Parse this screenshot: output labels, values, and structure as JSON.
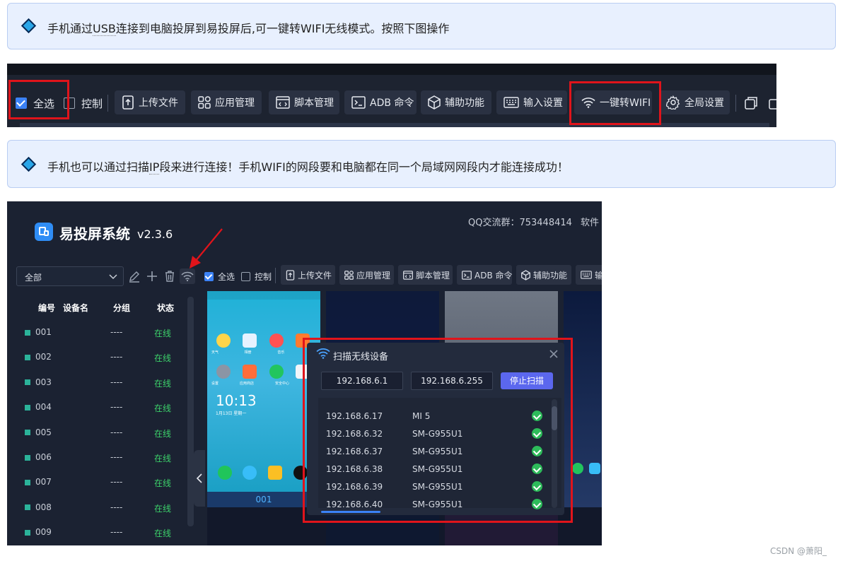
{
  "note1": {
    "pre": "手机通过",
    "usb": "USB",
    "post": "连接到电脑投屏到易投屏后,可一键转WIFI无线模式。按照下图操作"
  },
  "note2": {
    "pre": "手机也可以通过扫描",
    "ip": "IP",
    "post": "段来进行连接！手机WIFI的网段要和电脑都在同一个局域网网段内才能连接成功！"
  },
  "toolbar": {
    "select_all": "全选",
    "control": "控制",
    "upload": "上传文件",
    "apps": "应用管理",
    "scripts": "脚本管理",
    "adb": "ADB 命令",
    "assist": "辅助功能",
    "input": "输入设置",
    "wifi": "一键转WIFI",
    "global": "全局设置"
  },
  "app": {
    "title": "易投屏系统",
    "version": "v2.3.6",
    "qq": "QQ交流群：753448414",
    "software_partial": "软件",
    "group_select": "全部",
    "columns": {
      "id": "编号",
      "name": "设备名",
      "group": "分组",
      "status": "状态"
    },
    "devices": [
      {
        "id": "001",
        "group": "----",
        "status": "在线"
      },
      {
        "id": "002",
        "group": "----",
        "status": "在线"
      },
      {
        "id": "003",
        "group": "----",
        "status": "在线"
      },
      {
        "id": "004",
        "group": "----",
        "status": "在线"
      },
      {
        "id": "005",
        "group": "----",
        "status": "在线"
      },
      {
        "id": "006",
        "group": "----",
        "status": "在线"
      },
      {
        "id": "007",
        "group": "----",
        "status": "在线"
      },
      {
        "id": "008",
        "group": "----",
        "status": "在线"
      },
      {
        "id": "009",
        "group": "----",
        "status": "在线"
      }
    ],
    "toolbar": {
      "select_all": "全选",
      "control": "控制",
      "upload": "上传文件",
      "apps": "应用管理",
      "scripts": "脚本管理",
      "adb": "ADB 命令",
      "assist": "辅助功能",
      "input_partial": "输"
    },
    "phone": {
      "clock": "10:13",
      "date": "1月13日 星期一",
      "label": "001",
      "apps": [
        "天气",
        "相册",
        "音乐",
        "小说",
        "设置",
        "应用商店",
        "安全中心",
        "系统"
      ]
    },
    "dialog": {
      "title": "扫描无线设备",
      "ip_start": "192.168.6.1",
      "ip_end": "192.168.6.255",
      "stop_btn": "停止扫描",
      "results": [
        {
          "ip": "192.168.6.17",
          "model": "MI 5"
        },
        {
          "ip": "192.168.6.32",
          "model": "SM-G955U1"
        },
        {
          "ip": "192.168.6.37",
          "model": "SM-G955U1"
        },
        {
          "ip": "192.168.6.38",
          "model": "SM-G955U1"
        },
        {
          "ip": "192.168.6.39",
          "model": "SM-G955U1"
        },
        {
          "ip": "192.168.6.40",
          "model": "SM-G955U1"
        }
      ]
    }
  },
  "watermark": "CSDN @萧阳_",
  "colors": {
    "accent": "#3b82f6",
    "highlight": "#e0141b",
    "online": "#3cd16a",
    "dark_bg": "#1b2232"
  }
}
